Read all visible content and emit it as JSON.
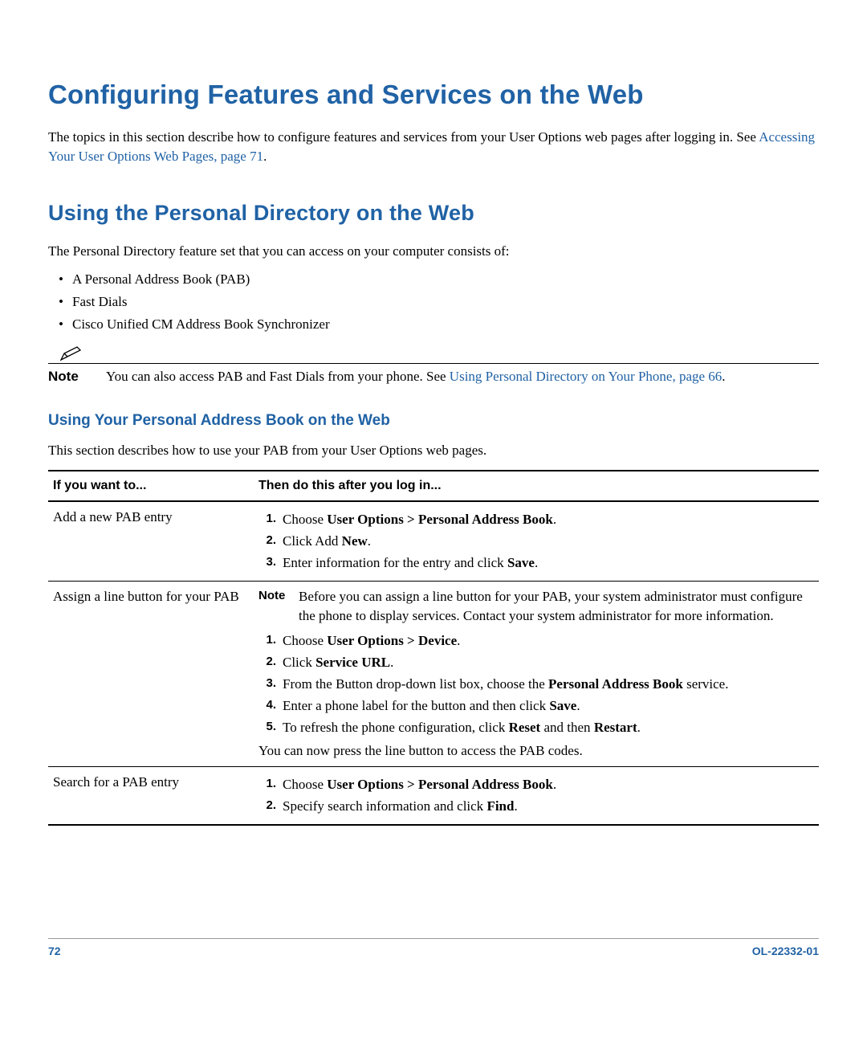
{
  "h1": "Configuring Features and Services on the Web",
  "intro": {
    "pre": "The topics in this section describe how to configure features and services from your User Options web pages after logging in. See ",
    "link": "Accessing Your User Options Web Pages, page 71",
    "post": "."
  },
  "h2": "Using the Personal Directory on the Web",
  "pd_intro": "The Personal Directory feature set that you can access on your computer consists of:",
  "pd_items": [
    "A Personal Address Book (PAB)",
    "Fast Dials",
    "Cisco Unified CM Address Book Synchronizer"
  ],
  "note": {
    "label": "Note",
    "pre": "You can also access PAB and Fast Dials from your phone. See ",
    "link": "Using Personal Directory on Your Phone, page 66",
    "post": "."
  },
  "h3": "Using Your Personal Address Book on the Web",
  "pab_intro": "This section describes how to use your PAB from your User Options web pages.",
  "table": {
    "headers": [
      "If you want to...",
      "Then do this after you log in..."
    ],
    "rows": [
      {
        "want": "Add a new PAB entry",
        "steps": [
          {
            "num": "1.",
            "text_html": "Choose <b>User Options > Personal Address Book</b>."
          },
          {
            "num": "2.",
            "text_html": "Click Add <b>New</b>."
          },
          {
            "num": "3.",
            "text_html": "Enter information for the entry and click <b>Save</b>."
          }
        ]
      },
      {
        "want": "Assign a line button for your PAB",
        "note": {
          "label": "Note",
          "text": "Before you can assign a line button for your PAB, your system administrator must configure the phone to display services. Contact your system administrator for more information."
        },
        "steps": [
          {
            "num": "1.",
            "text_html": "Choose <b>User Options > Device</b>."
          },
          {
            "num": "2.",
            "text_html": "Click <b>Service URL</b>."
          },
          {
            "num": "3.",
            "text_html": "From the Button drop-down list box, choose the <b>Personal Address Book</b> service."
          },
          {
            "num": "4.",
            "text_html": "Enter a phone label for the button and then click <b>Save</b>."
          },
          {
            "num": "5.",
            "text_html": "To refresh the phone configuration, click <b>Reset</b> and then <b>Restart</b>."
          }
        ],
        "after": "You can now press the line button to access the PAB codes."
      },
      {
        "want": "Search for a PAB entry",
        "steps": [
          {
            "num": "1.",
            "text_html": "Choose <b>User Options > Personal Address Book</b>."
          },
          {
            "num": "2.",
            "text_html": "Specify search information and click <b>Find</b>."
          }
        ]
      }
    ]
  },
  "footer": {
    "page": "72",
    "docid": "OL-22332-01"
  }
}
